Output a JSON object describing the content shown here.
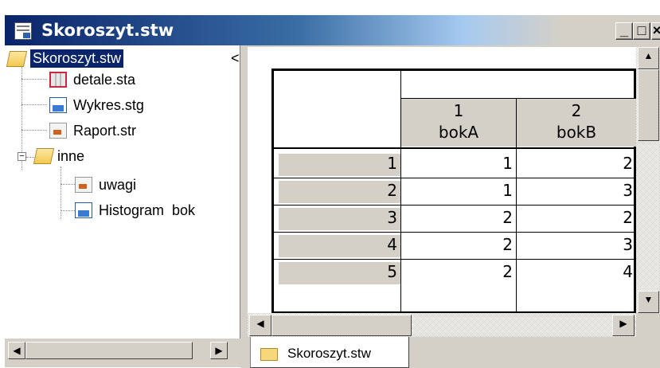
{
  "window": {
    "title": "Skoroszyt.stw",
    "controls": {
      "minimize": "_",
      "maximize": "□",
      "close": "×"
    }
  },
  "tree": {
    "root": "Skoroszyt.stw",
    "items": [
      {
        "label": "detale.sta",
        "icon": "spreadsheet-icon"
      },
      {
        "label": "Wykres.stg",
        "icon": "graph-icon"
      },
      {
        "label": "Raport.str",
        "icon": "report-icon"
      },
      {
        "label": "inne",
        "icon": "folder-open-icon",
        "expander": "−"
      },
      {
        "label": "uwagi",
        "icon": "report-icon"
      },
      {
        "label": "Histogram  bok",
        "icon": "graph-icon"
      }
    ],
    "collapse_glyph": "<"
  },
  "spreadsheet": {
    "columns": [
      {
        "number": "1",
        "name": "bokA"
      },
      {
        "number": "2",
        "name": "bokB"
      }
    ],
    "rows": [
      {
        "case": "1",
        "values": [
          "1",
          "2"
        ]
      },
      {
        "case": "2",
        "values": [
          "1",
          "3"
        ]
      },
      {
        "case": "3",
        "values": [
          "2",
          "2"
        ]
      },
      {
        "case": "4",
        "values": [
          "2",
          "3"
        ]
      },
      {
        "case": "5",
        "values": [
          "2",
          "4"
        ]
      }
    ]
  },
  "tabs": [
    {
      "label": "Skoroszyt.stw"
    }
  ],
  "scroll": {
    "left_arrow": "◀",
    "right_arrow": "▶",
    "up_arrow": "▲",
    "down_arrow": "▼"
  }
}
